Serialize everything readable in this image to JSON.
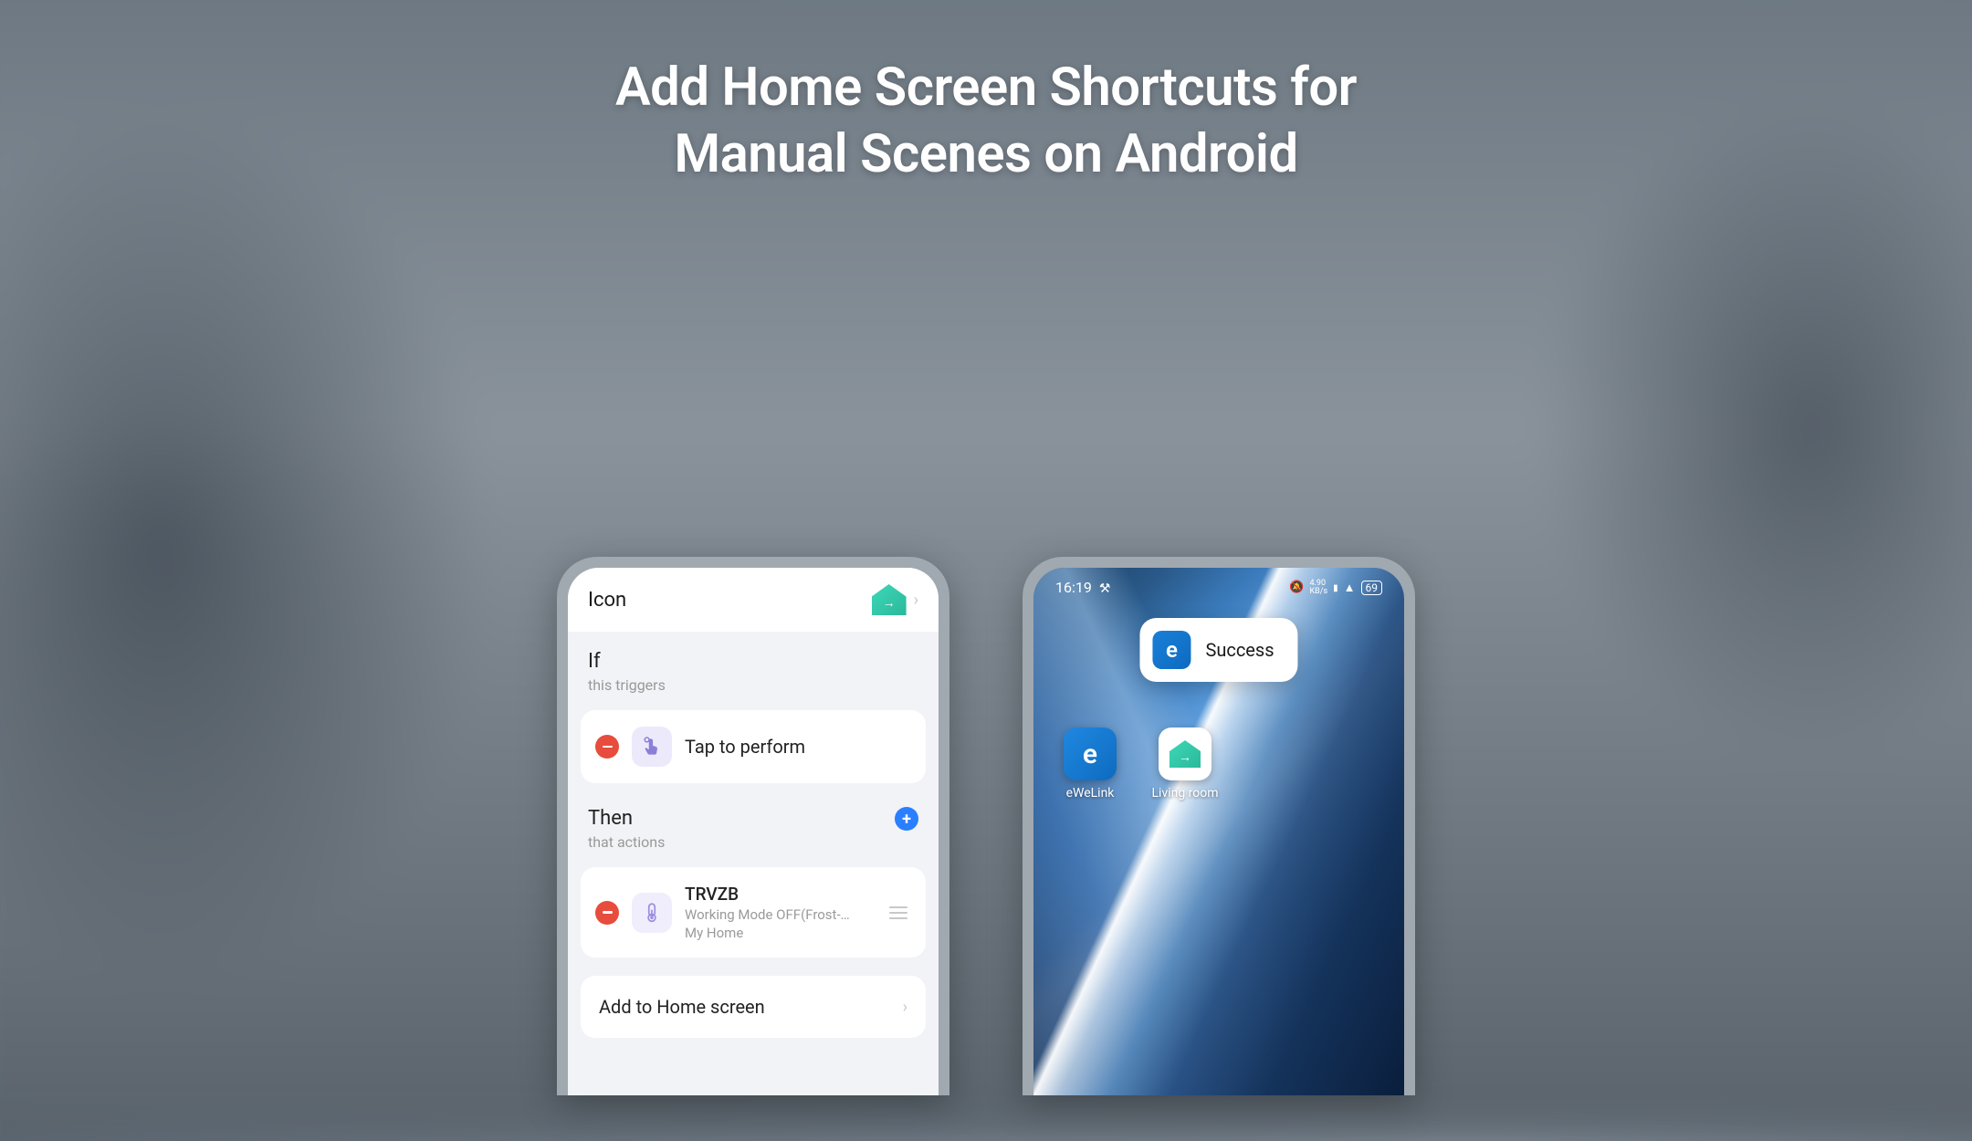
{
  "headline": {
    "line1": "Add Home Screen Shortcuts for",
    "line2": "Manual Scenes on Android"
  },
  "left_phone": {
    "icon_row_label": "Icon",
    "if_section": {
      "title": "If",
      "subtitle": "this triggers"
    },
    "trigger_card": {
      "label": "Tap to perform"
    },
    "then_section": {
      "title": "Then",
      "subtitle": "that actions"
    },
    "action_card": {
      "title": "TRVZB",
      "subtitle": "Working Mode OFF(Frost-…",
      "home": "My Home"
    },
    "add_home_label": "Add to Home screen"
  },
  "right_phone": {
    "status": {
      "time": "16:19",
      "battery": "69"
    },
    "toast": {
      "text": "Success"
    },
    "apps": [
      {
        "label": "eWeLink",
        "kind": "ewelink"
      },
      {
        "label": "Living room",
        "kind": "scene"
      }
    ]
  },
  "icons": {
    "chevron": "›",
    "plus": "+",
    "battery_label": "69"
  }
}
